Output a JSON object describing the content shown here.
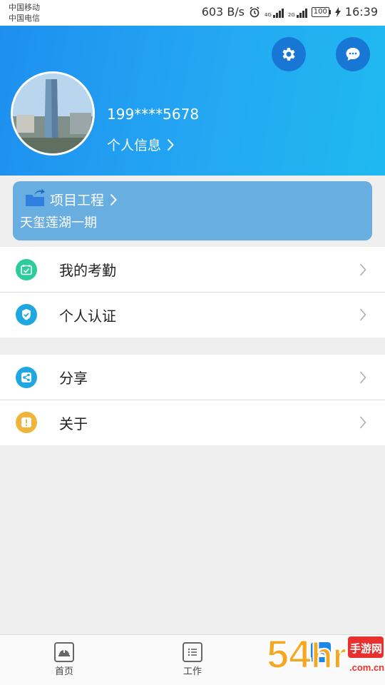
{
  "status": {
    "carrier1": "中国移动",
    "carrier2": "中国电信",
    "net_speed": "603 B/s",
    "net1": "4G",
    "net2": "2G",
    "battery": "100",
    "time": "16:39"
  },
  "header": {
    "settings_icon": "gear-icon",
    "message_icon": "chat-bubble-icon",
    "phone": "199****5678",
    "personal_info": "个人信息",
    "colors": {
      "gradient_start": "#1e8ff0",
      "gradient_end": "#1fb9f0",
      "button_bg": "#1877d4"
    }
  },
  "project": {
    "title": "项目工程",
    "name": "天玺莲湖一期",
    "color": "#69aee0"
  },
  "menu": {
    "group1": [
      {
        "label": "我的考勤",
        "icon": "calendar-check-icon",
        "color": "#2ecc9a"
      },
      {
        "label": "个人认证",
        "icon": "shield-check-icon",
        "color": "#1ea7e0"
      }
    ],
    "group2": [
      {
        "label": "分享",
        "icon": "share-icon",
        "color": "#1ea7e0"
      },
      {
        "label": "关于",
        "icon": "exclamation-icon",
        "color": "#f0b43a"
      }
    ]
  },
  "tabbar": {
    "tabs": [
      {
        "label": "首页",
        "icon": "helmet-icon"
      },
      {
        "label": "工作",
        "icon": "list-icon"
      },
      {
        "label": "",
        "icon": "profile-icon",
        "active": true
      }
    ]
  },
  "watermark": {
    "text": "54hr手游网",
    "sub": ".com.cn"
  }
}
